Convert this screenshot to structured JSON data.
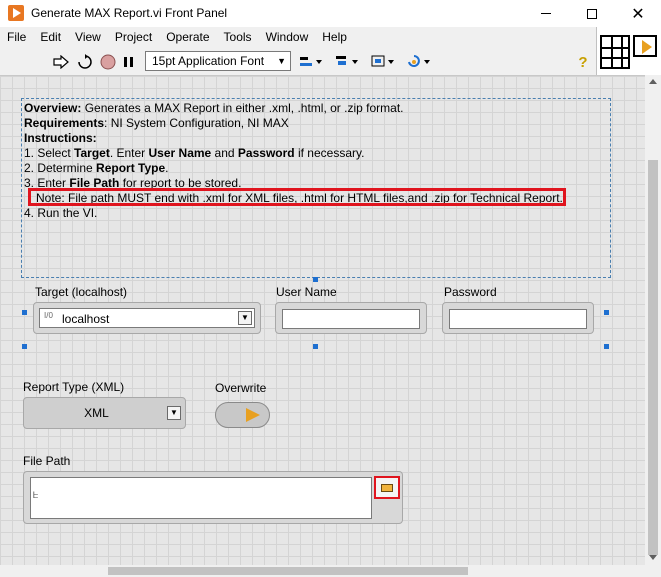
{
  "window": {
    "title": "Generate MAX Report.vi Front Panel"
  },
  "menu": [
    "File",
    "Edit",
    "View",
    "Project",
    "Operate",
    "Tools",
    "Window",
    "Help"
  ],
  "toolbar": {
    "font_select": "15pt Application Font",
    "help_glyph": "?"
  },
  "description": {
    "overview_label": "Overview:",
    "overview_text": " Generates a MAX Report in either .xml, .html, or .zip format.",
    "requirements_label": "Requirements",
    "requirements_text": ": NI System Configuration, NI MAX",
    "instructions_label": "Instructions:",
    "step1_a": "1. Select ",
    "step1_b": "Target",
    "step1_c": ". Enter ",
    "step1_d": "User Name",
    "step1_e": " and ",
    "step1_f": "Password",
    "step1_g": " if necessary.",
    "step2_a": "2. Determine ",
    "step2_b": "Report Type",
    "step2_c": ".",
    "step3_a": "3. Enter ",
    "step3_b": "File Path",
    "step3_c": " for report to be stored.",
    "note": "Note: File path MUST end with .xml for XML files, .html for HTML files,and .zip for Technical Report.",
    "step4": "4. Run the VI."
  },
  "controls": {
    "target_label": "Target (localhost)",
    "target_value": "localhost",
    "target_prefix": "I/0",
    "username_label": "User Name",
    "username_value": "",
    "password_label": "Password",
    "password_value": "",
    "report_type_label": "Report Type (XML)",
    "report_type_value": "XML",
    "overwrite_label": "Overwrite",
    "file_path_label": "File Path",
    "file_path_value": ""
  },
  "colors": {
    "highlight": "#e0141e",
    "selection": "#1e6fd0",
    "accent": "#e8a020"
  }
}
